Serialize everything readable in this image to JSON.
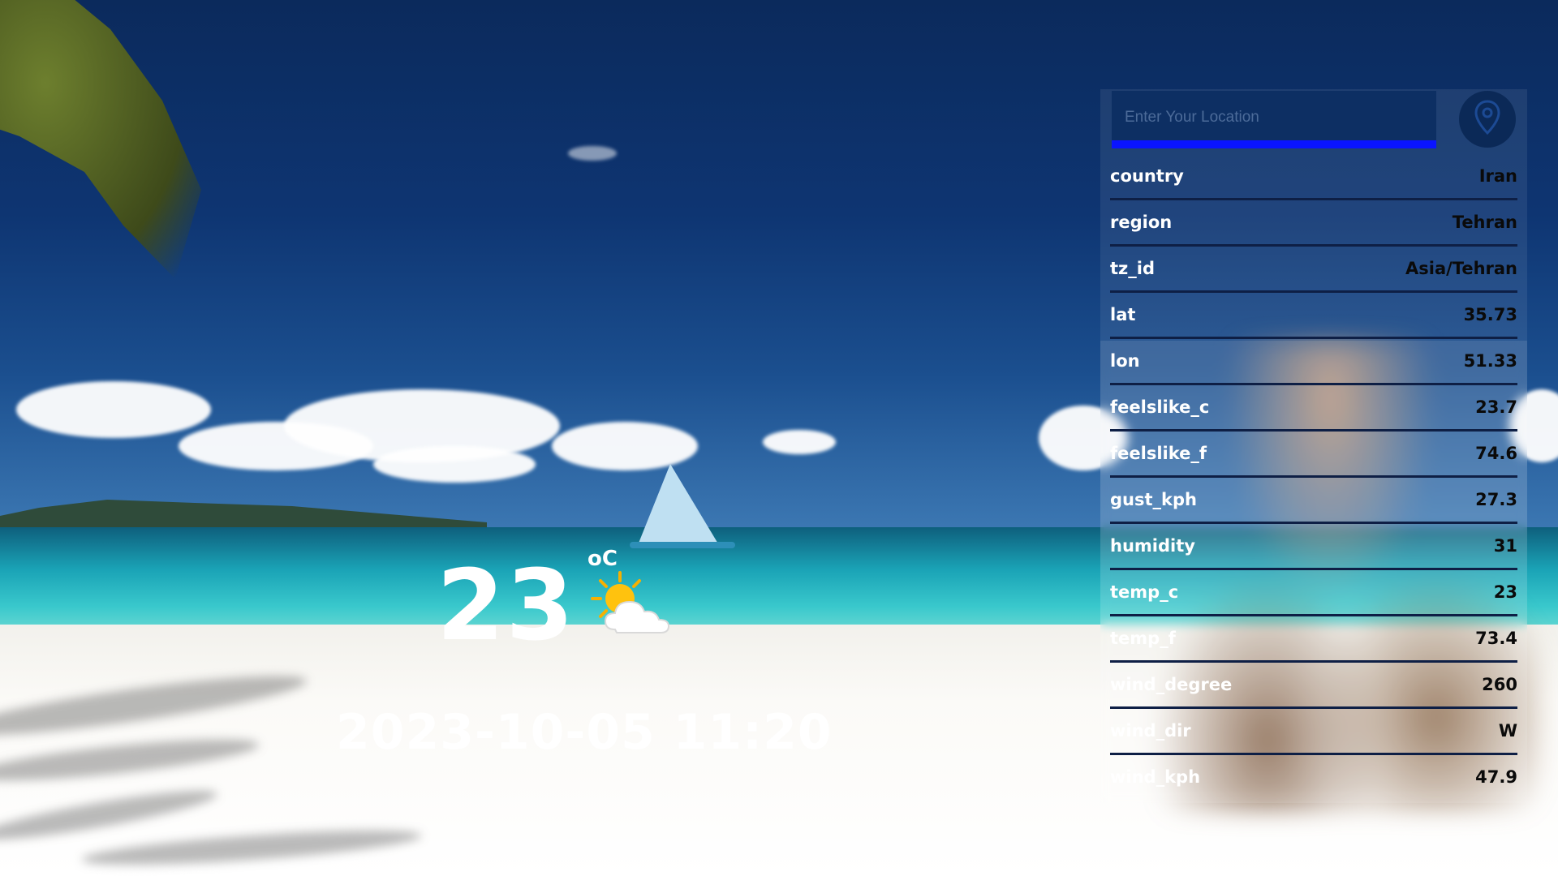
{
  "search": {
    "placeholder": "Enter Your Location",
    "value": ""
  },
  "locate_button": {
    "icon": "location-pin-icon"
  },
  "current": {
    "temperature": "23",
    "unit": "oC",
    "condition_icon": "partly-sunny-icon",
    "datetime": "2023-10-05 11:20"
  },
  "details": [
    {
      "key": "country",
      "value": "Iran"
    },
    {
      "key": "region",
      "value": "Tehran"
    },
    {
      "key": "tz_id",
      "value": "Asia/Tehran"
    },
    {
      "key": "lat",
      "value": "35.73"
    },
    {
      "key": "lon",
      "value": "51.33"
    },
    {
      "key": "feelslike_c",
      "value": "23.7"
    },
    {
      "key": "feelslike_f",
      "value": "74.6"
    },
    {
      "key": "gust_kph",
      "value": "27.3"
    },
    {
      "key": "humidity",
      "value": "31"
    },
    {
      "key": "temp_c",
      "value": "23"
    },
    {
      "key": "temp_f",
      "value": "73.4"
    },
    {
      "key": "wind_degree",
      "value": "260"
    },
    {
      "key": "wind_dir",
      "value": "W"
    },
    {
      "key": "wind_kph",
      "value": "47.9"
    }
  ],
  "colors": {
    "search_underline": "#0a14ff",
    "search_box": "#0d2f63",
    "locate_button": "#0b2957",
    "row_divider": "#0e1f45"
  }
}
